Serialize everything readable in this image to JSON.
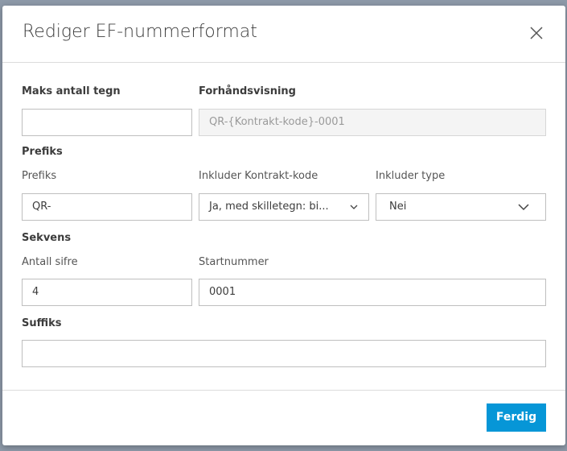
{
  "dialog": {
    "title": "Rediger EF-nummerformat",
    "max_chars": {
      "label": "Maks antall tegn",
      "value": ""
    },
    "preview": {
      "label": "Forhåndsvisning",
      "value": "QR-{Kontrakt-kode}-0001"
    },
    "prefix_section": "Prefiks",
    "prefix": {
      "label": "Prefiks",
      "value": "QR-"
    },
    "include_contract_code": {
      "label": "Inkluder Kontrakt-kode",
      "value": "Ja, med skilletegn: bi..."
    },
    "include_type": {
      "label": "Inkluder type",
      "value": "Nei"
    },
    "sequence_section": "Sekvens",
    "digits": {
      "label": "Antall sifre",
      "value": "4"
    },
    "start_number": {
      "label": "Startnummer",
      "value": "0001"
    },
    "suffix_section": "Suffiks",
    "suffix": {
      "value": ""
    },
    "done_label": "Ferdig"
  },
  "colors": {
    "accent": "#0696d7"
  }
}
